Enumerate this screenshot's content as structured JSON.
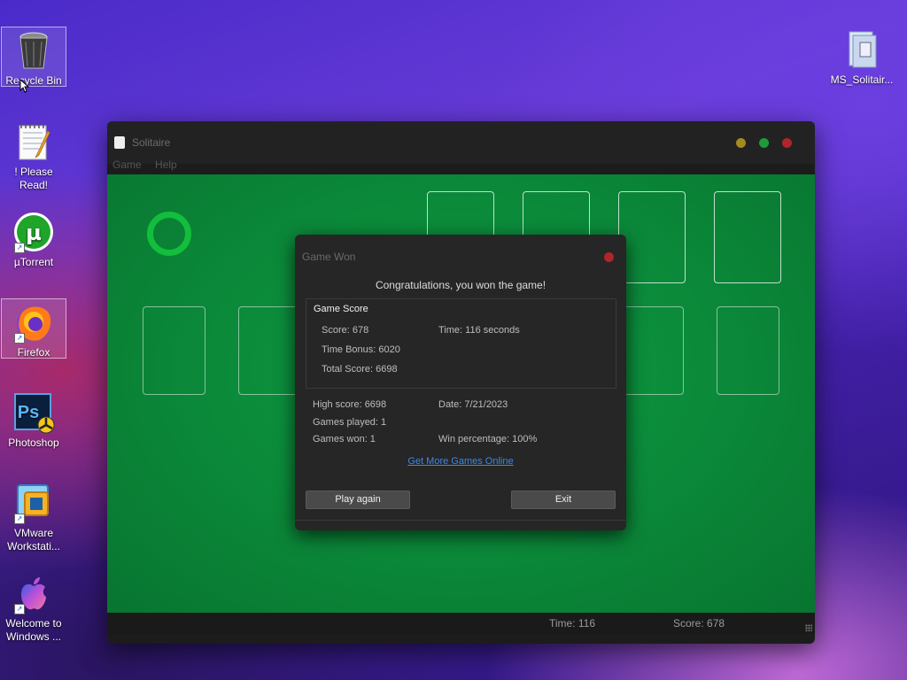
{
  "desktop": {
    "icons": [
      {
        "label": "Recycle Bin",
        "icon": "recycle-bin-icon"
      },
      {
        "label": "! Please Read!",
        "icon": "notepad-icon"
      },
      {
        "label": "µTorrent",
        "icon": "utorrent-icon"
      },
      {
        "label": "Firefox",
        "icon": "firefox-icon"
      },
      {
        "label": "Photoshop",
        "icon": "photoshop-icon"
      },
      {
        "label": "VMware Workstati...",
        "icon": "vmware-icon"
      },
      {
        "label": "Welcome to Windows ...",
        "icon": "apple-icon"
      },
      {
        "label": "MS_Solitair...",
        "icon": "folder-icon"
      }
    ]
  },
  "window": {
    "title": "Solitaire",
    "menu": [
      "Game",
      "Help"
    ],
    "controls": {
      "minimize_color": "#a58a1f",
      "maximize_color": "#1e9a3a",
      "close_color": "#b0242c"
    },
    "status": {
      "time": "Time:  116",
      "score": "Score: 678"
    }
  },
  "dialog": {
    "title": "Game Won",
    "congrats": "Congratulations, you won the game!",
    "score_header": "Game Score",
    "score": "Score: 678",
    "time": "Time:  116 seconds",
    "time_bonus": "Time Bonus: 6020",
    "total_score": "Total Score: 6698",
    "high_score": "High score: 6698",
    "date": "Date: 7/21/2023",
    "games_played": "Games played: 1",
    "games_won": "Games won: 1",
    "win_percentage": "Win percentage: 100%",
    "link": "Get More Games Online",
    "play_again": "Play again",
    "exit": "Exit"
  }
}
